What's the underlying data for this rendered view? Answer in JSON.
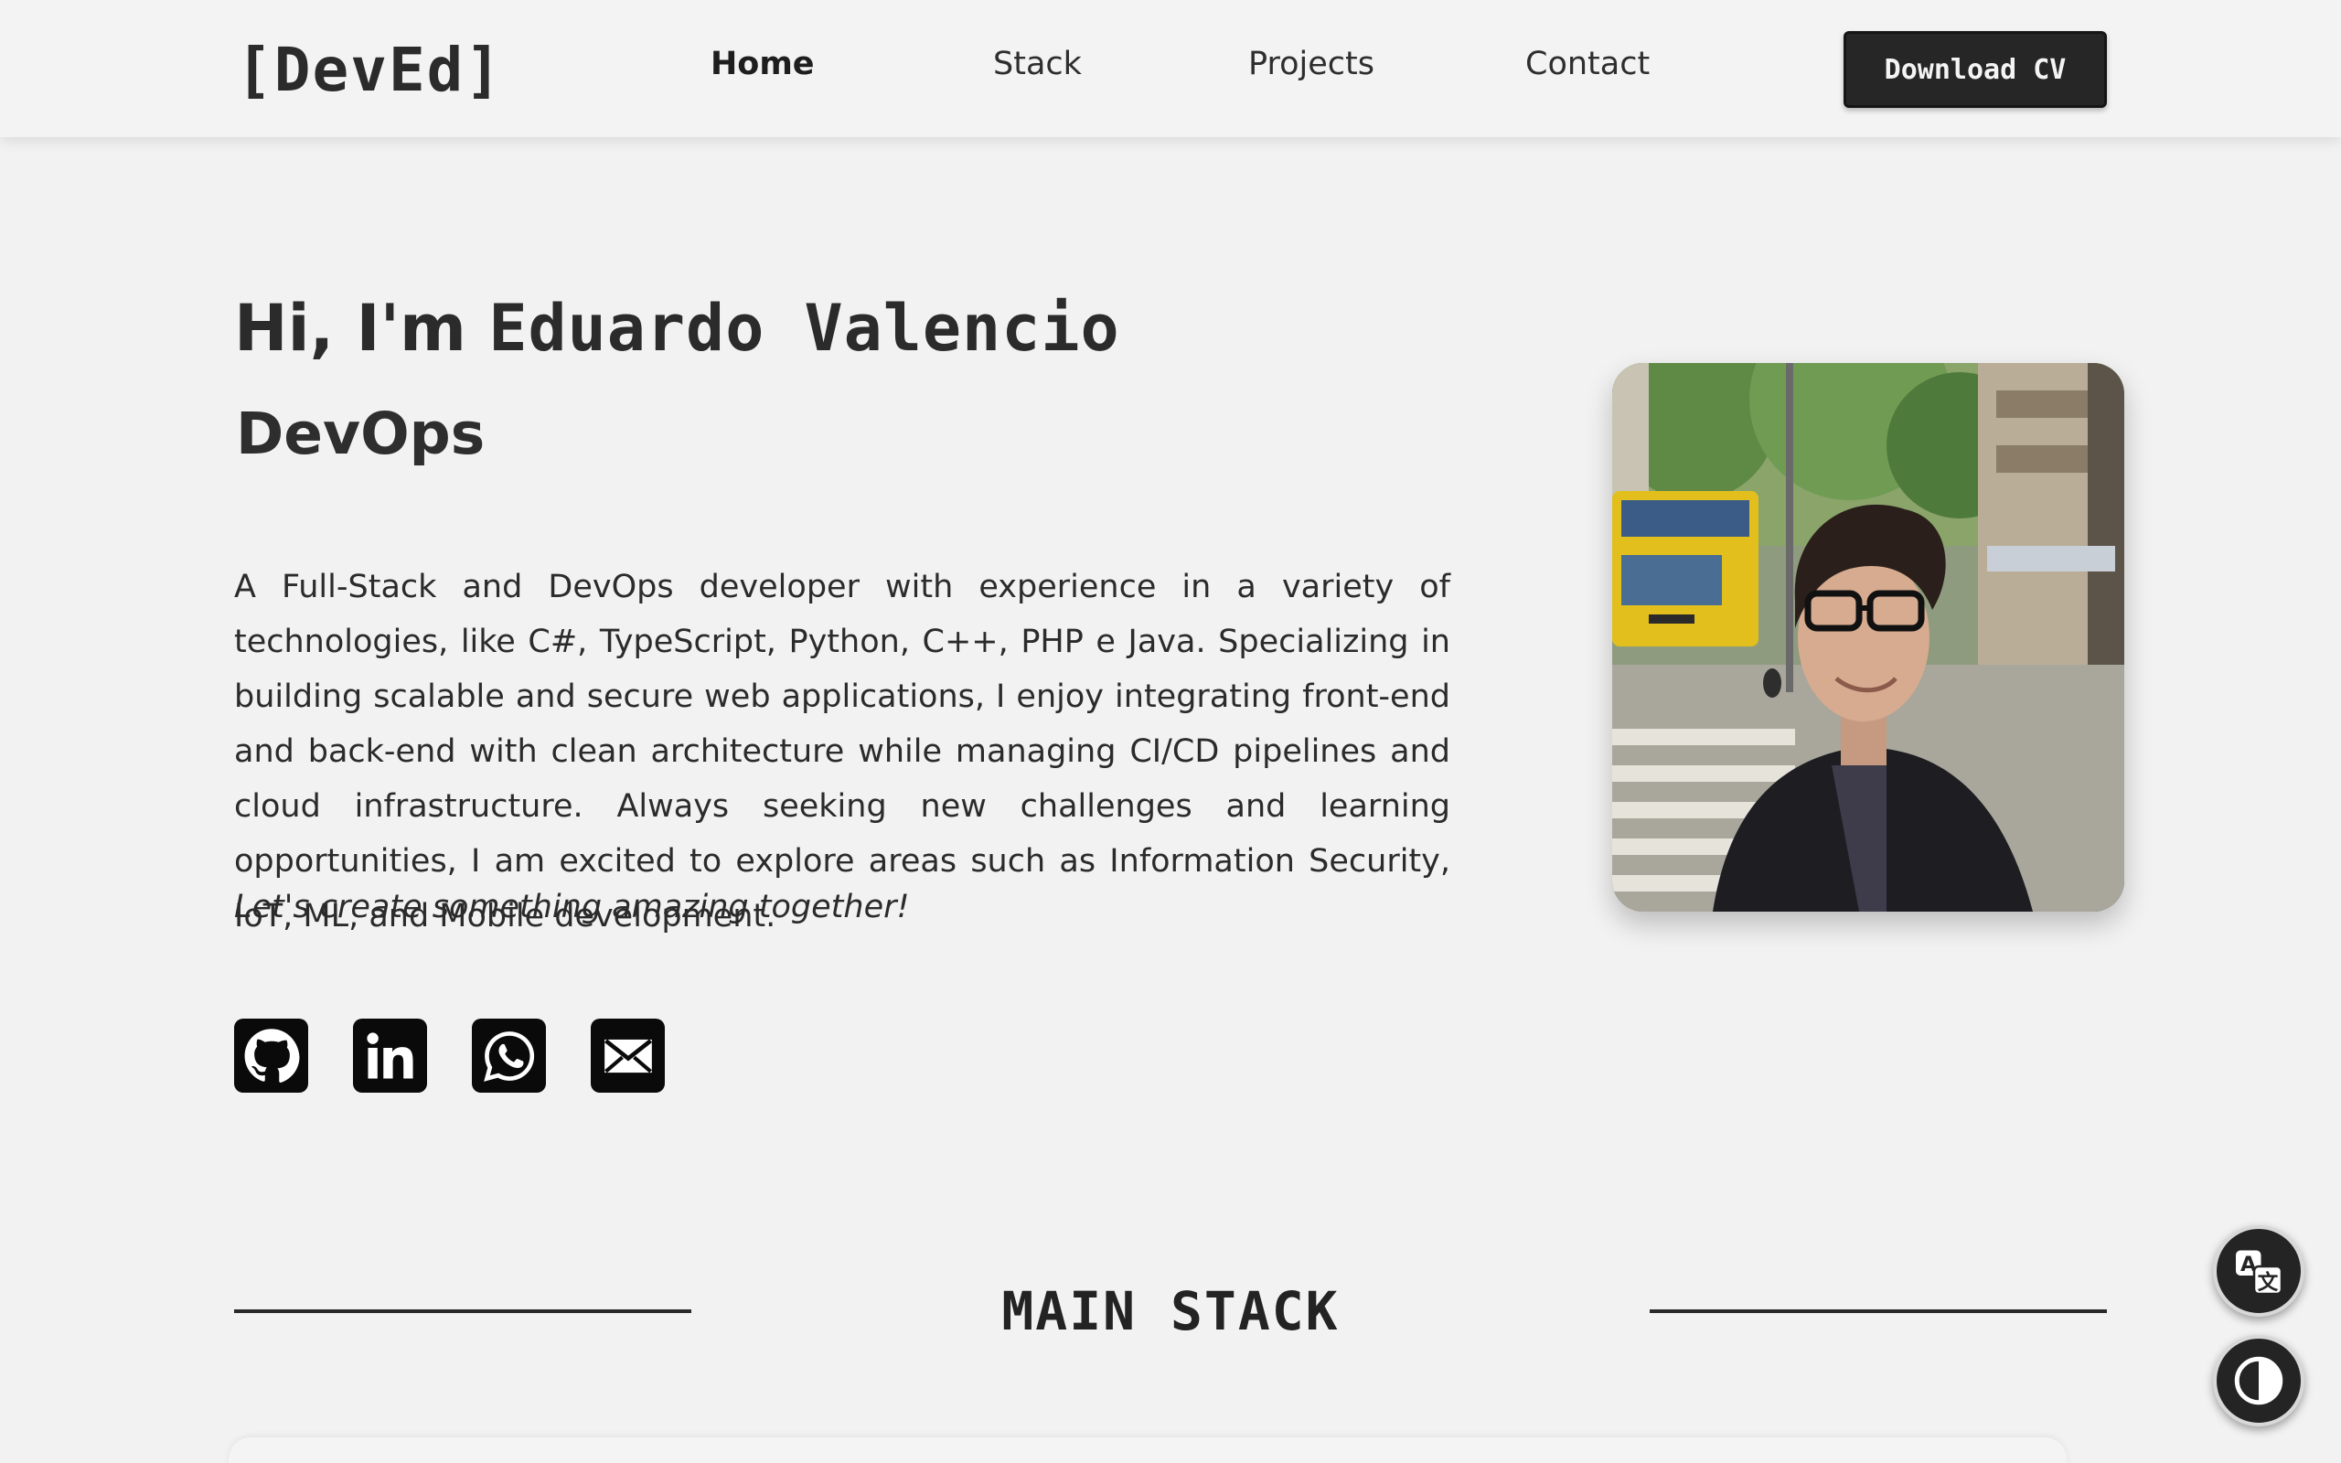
{
  "header": {
    "logo": "[DevEd]",
    "nav": {
      "home": "Home",
      "stack": "Stack",
      "projects": "Projects",
      "contact": "Contact"
    },
    "cv_button": "Download CV"
  },
  "hero": {
    "greeting_prefix": "Hi, I'm ",
    "name": "Eduardo Valencio",
    "role": "DevOps",
    "bio": "A Full-Stack and DevOps developer with experience in a variety of technologies, like C#, TypeScript, Python, C++, PHP e Java. Specializing in building scalable and secure web applications, I enjoy integrating front-end and back-end with clean architecture while managing CI/CD pipelines and cloud infrastructure. Always seeking new challenges and learning opportunities, I am excited to explore areas such as Information Security, IoT, ML, and Mobile development.",
    "tagline": "Let's create something amazing together!",
    "socials": [
      "github-icon",
      "linkedin-icon",
      "whatsapp-icon",
      "email-icon"
    ]
  },
  "sections": {
    "main_stack_title": "MAIN STACK"
  },
  "floating": {
    "translate": "translate-icon",
    "theme": "theme-toggle-icon"
  },
  "colors": {
    "background": "#f2f2f2",
    "text": "#262626",
    "button": "#262626"
  }
}
